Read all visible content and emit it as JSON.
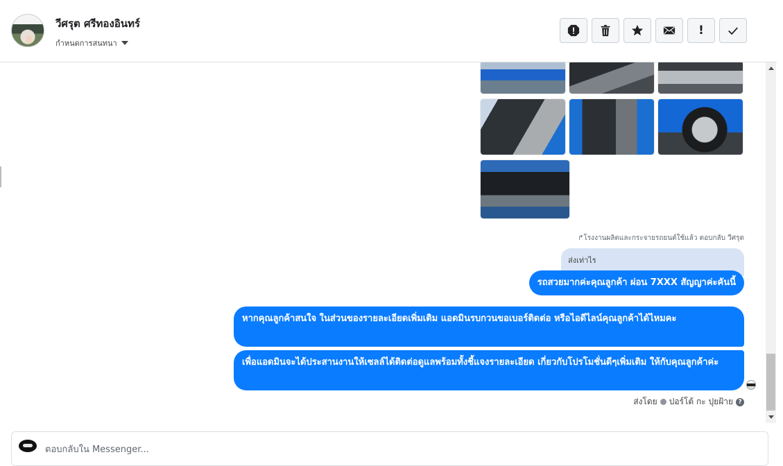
{
  "header": {
    "name": "วีศรุต ศรีทองอินทร์",
    "assign_label": "กำหนดการสนทนา",
    "buttons": [
      {
        "name": "spam-icon",
        "label": ""
      },
      {
        "name": "trash-icon",
        "label": ""
      },
      {
        "name": "star-icon",
        "label": ""
      },
      {
        "name": "mail-icon",
        "label": ""
      },
      {
        "name": "exclamation-icon",
        "label": "!"
      },
      {
        "name": "check-icon",
        "label": ""
      }
    ]
  },
  "chat": {
    "photos": [
      "car-exterior",
      "interior-dashboard",
      "interior-rear",
      "interior-seat",
      "door-panel",
      "wheel",
      "engine-bay"
    ],
    "reply_note": "↱โรงงานผลิตและกระจายรถยนต์ใช้แล้ว ตอบกลับ วีศรุต",
    "quoted_text": "ส่งเท่าไร",
    "messages": [
      "รถสวยมากค่ะคุณลูกค้า ผ่อน 7XXX สัญญาค่ะคันนี้",
      "หากคุณลูกค้าสนใจ ในส่วนของรายละเอียดเพิ่มเติม แอดมินรบกวนขอเบอร์ติดต่อ หรือไอดีไลน์คุณลูกค้าได้ไหมคะ",
      "เพื่อแอดมินจะได้ประสานงานให้เซลล์ได้ติดต่อดูแลพร้อมทั้งชี้แจงรายละเอียด เกี่ยวกับโปรโมชั่นดีๆเพิ่มเติม ให้กับคุณลูกค้าค่ะ"
    ],
    "sent_by_label": "ส่งโดย",
    "sent_by_name": "ปอร์โต้ กะ ปุยฝ้าย"
  },
  "composer": {
    "placeholder": "ตอบกลับใน Messenger..."
  },
  "colors": {
    "accent": "#0a7cff",
    "quoted_bg": "#d8e4f5"
  }
}
